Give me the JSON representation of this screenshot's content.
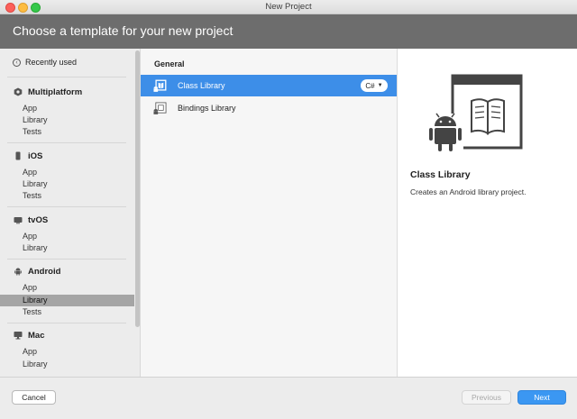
{
  "window": {
    "title": "New Project"
  },
  "header": {
    "title": "Choose a template for your new project"
  },
  "sidebar": {
    "recent": {
      "label": "Recently used",
      "icon": "chevron-left-icon"
    },
    "sections": [
      {
        "label": "Multiplatform",
        "icon": "multiplatform-icon",
        "items": [
          "App",
          "Library",
          "Tests"
        ]
      },
      {
        "label": "iOS",
        "icon": "phone-icon",
        "items": [
          "App",
          "Library",
          "Tests"
        ]
      },
      {
        "label": "tvOS",
        "icon": "tv-icon",
        "items": [
          "App",
          "Library"
        ]
      },
      {
        "label": "Android",
        "icon": "android-icon",
        "items": [
          "App",
          "Library",
          "Tests"
        ],
        "selected_item": "Library"
      },
      {
        "label": "Mac",
        "icon": "monitor-icon",
        "items": [
          "App",
          "Library"
        ]
      }
    ]
  },
  "templates": {
    "heading": "General",
    "items": [
      {
        "label": "Class Library",
        "selected": true,
        "language": "C#"
      },
      {
        "label": "Bindings Library",
        "selected": false
      }
    ]
  },
  "detail": {
    "title": "Class Library",
    "description": "Creates an Android library project."
  },
  "footer": {
    "cancel_label": "Cancel",
    "previous_label": "Previous",
    "next_label": "Next"
  },
  "colors": {
    "header_bg": "#6d6d6d",
    "selection_blue": "#3d8ee8",
    "next_button": "#3b97f2",
    "sidebar_selected": "#a5a5a5"
  }
}
